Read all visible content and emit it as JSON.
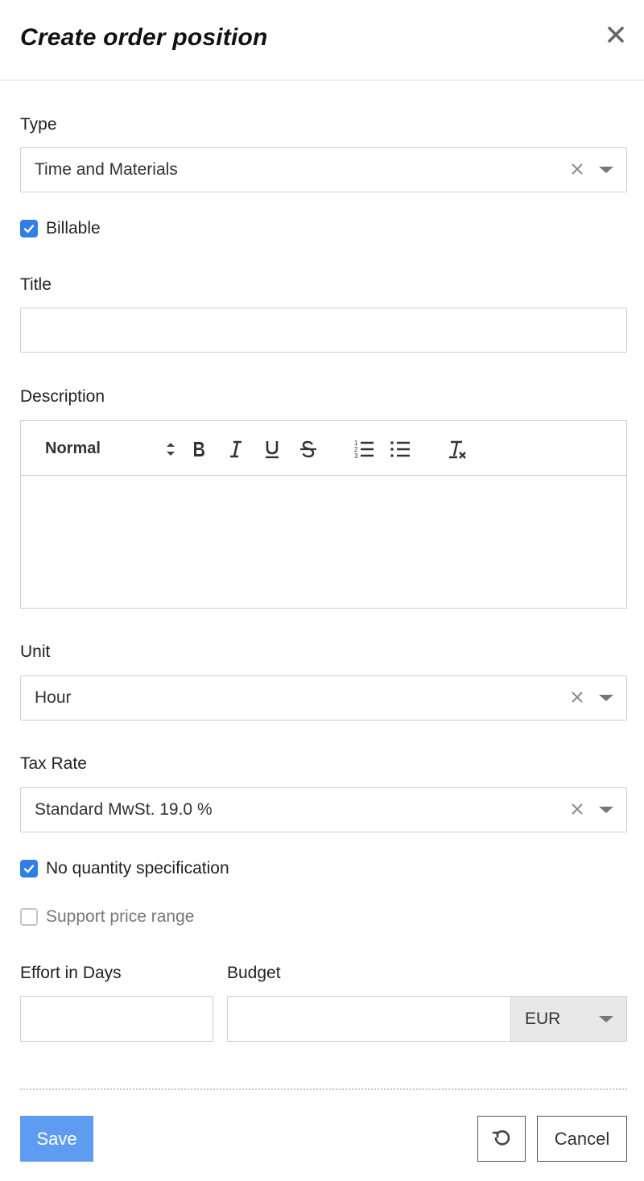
{
  "dialog": {
    "title": "Create order position"
  },
  "form": {
    "type": {
      "label": "Type",
      "value": "Time and Materials"
    },
    "billable": {
      "label": "Billable",
      "checked": true
    },
    "title": {
      "label": "Title",
      "value": ""
    },
    "description": {
      "label": "Description",
      "heading_select": "Normal",
      "value": ""
    },
    "unit": {
      "label": "Unit",
      "value": "Hour"
    },
    "tax_rate": {
      "label": "Tax Rate",
      "value": "Standard MwSt. 19.0 %"
    },
    "no_quantity": {
      "label": "No quantity specification",
      "checked": true
    },
    "support_price_range": {
      "label": "Support price range",
      "checked": false
    },
    "effort": {
      "label": "Effort in Days",
      "value": ""
    },
    "budget": {
      "label": "Budget",
      "value": "",
      "currency": "EUR"
    }
  },
  "actions": {
    "save_label": "Save",
    "cancel_label": "Cancel"
  },
  "colors": {
    "accent": "#2f7fe6",
    "save_button": "#5e9cf2"
  }
}
